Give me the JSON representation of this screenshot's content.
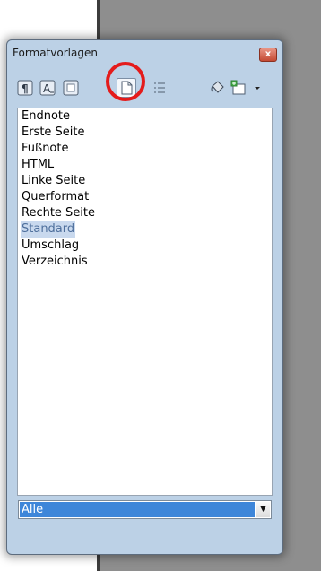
{
  "window": {
    "title": "Formatvorlagen",
    "close_label": "x"
  },
  "toolbar": {
    "buttons": [
      {
        "name": "paragraph-styles",
        "icon": "paragraph-style-icon"
      },
      {
        "name": "character-styles",
        "icon": "character-style-icon"
      },
      {
        "name": "frame-styles",
        "icon": "frame-style-icon"
      },
      {
        "name": "page-styles",
        "icon": "page-style-icon",
        "active": true
      },
      {
        "name": "list-styles",
        "icon": "list-style-icon"
      },
      {
        "name": "fill-format-mode",
        "icon": "fill-bucket-icon"
      },
      {
        "name": "new-style-from-selection",
        "icon": "new-style-icon"
      },
      {
        "name": "more-options",
        "icon": "dropdown-arrow-icon"
      }
    ]
  },
  "styles_list": {
    "items": [
      "Endnote",
      "Erste Seite",
      "Fußnote",
      "HTML",
      "Linke Seite",
      "Querformat",
      "Rechte Seite",
      "Standard",
      "Umschlag",
      "Verzeichnis"
    ],
    "selected": "Standard"
  },
  "filter": {
    "value": "Alle",
    "arrow": "▼"
  },
  "colors": {
    "highlight_ring": "#e41b1b",
    "selection": "#3e86d9"
  }
}
